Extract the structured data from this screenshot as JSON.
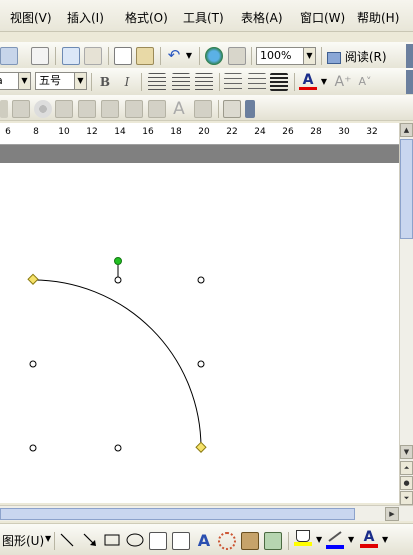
{
  "menu": {
    "items": [
      "视图(V)",
      "插入(I)",
      "格式(O)",
      "工具(T)",
      "表格(A)",
      "窗口(W)",
      "帮助(H)"
    ]
  },
  "toolbar_standard": {
    "zoom": "100%",
    "read_label": "阅读(R)"
  },
  "toolbar_format": {
    "font_size": "五号",
    "bold_label": "B",
    "italic_label": "I",
    "style_fragment": "a",
    "font_color": "#e00000"
  },
  "ruler": {
    "labels": [
      "6",
      "8",
      "10",
      "12",
      "14",
      "16",
      "18",
      "20",
      "22",
      "24",
      "26",
      "28",
      "30",
      "32"
    ]
  },
  "drawing_toolbar": {
    "draw_label": "图形(U)"
  },
  "colors": {
    "fill_color": "#ffff00",
    "line_color": "#0000ff",
    "font_color": "#e00000"
  }
}
